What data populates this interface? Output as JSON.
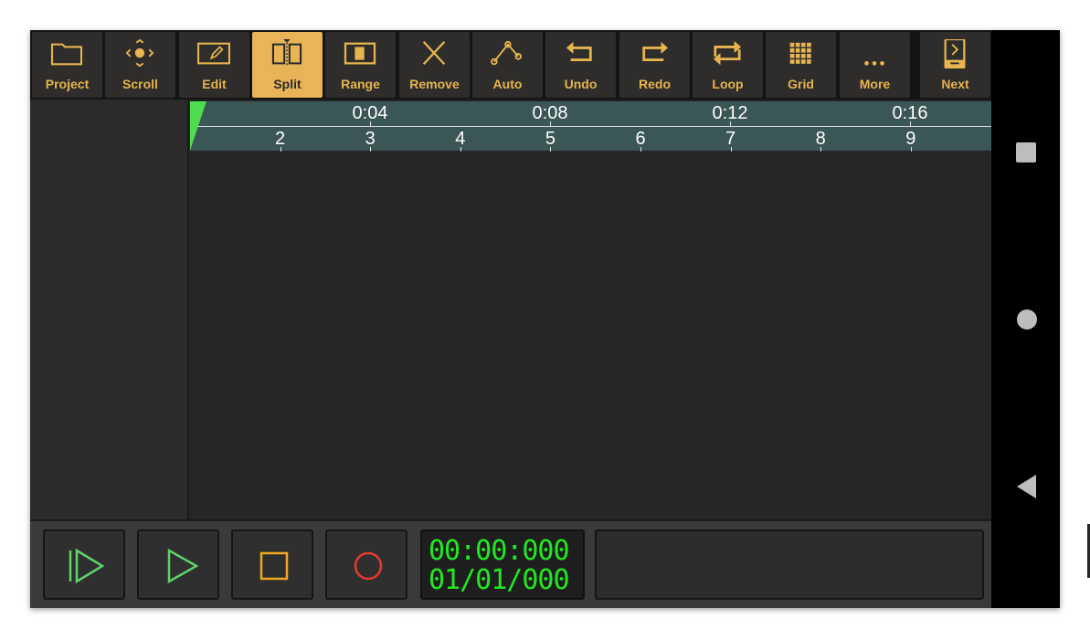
{
  "toolbar": {
    "buttons": [
      {
        "label": "Project",
        "icon": "folder-icon"
      },
      {
        "label": "Scroll",
        "icon": "scroll-icon"
      },
      {
        "label": "Edit",
        "icon": "edit-icon"
      },
      {
        "label": "Split",
        "icon": "split-icon",
        "active": true
      },
      {
        "label": "Range",
        "icon": "range-icon"
      },
      {
        "label": "Remove",
        "icon": "remove-icon"
      },
      {
        "label": "Auto",
        "icon": "automation-icon"
      },
      {
        "label": "Undo",
        "icon": "undo-icon"
      },
      {
        "label": "Redo",
        "icon": "redo-icon"
      },
      {
        "label": "Loop",
        "icon": "loop-icon"
      },
      {
        "label": "Grid",
        "icon": "grid-icon"
      },
      {
        "label": "More",
        "icon": "more-icon"
      },
      {
        "label": "Next",
        "icon": "next-icon"
      }
    ]
  },
  "ruler": {
    "times": [
      "0:04",
      "0:08",
      "0:12",
      "0:16"
    ],
    "bars": [
      "2",
      "3",
      "4",
      "5",
      "6",
      "7",
      "8",
      "9"
    ]
  },
  "transport": {
    "time": "00:00:000",
    "position": "01/01/000"
  },
  "colors": {
    "accent": "#e8b457",
    "ruler": "#3a5655",
    "display": "#22e822",
    "record": "#e53a2a",
    "play": "#5fd46a"
  }
}
